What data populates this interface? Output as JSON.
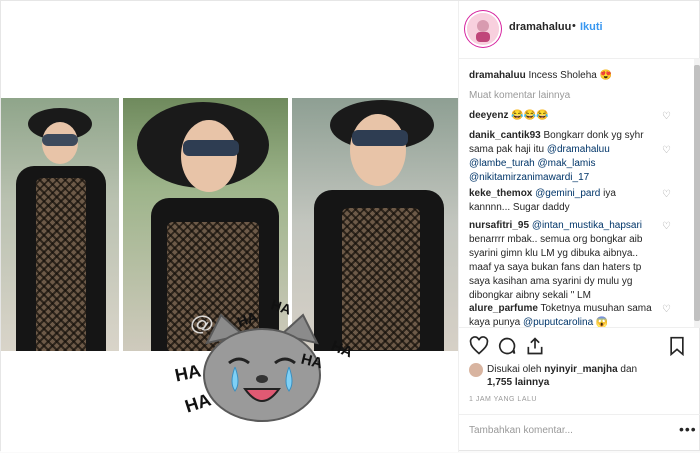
{
  "post": {
    "username": "dramahaluu",
    "separator": "•",
    "follow_label": "Ikuti",
    "watermark": "@dramahaluu",
    "haha": [
      "HA",
      "HA",
      "HA",
      "HA",
      "HA",
      "HA"
    ],
    "more_comments_label": "Muat komentar lainnya",
    "caption": {
      "user": "dramahaluu",
      "text": "Incess Sholeha 😍"
    },
    "comments": [
      {
        "user": "deeyenz",
        "text": "😂😂😂"
      },
      {
        "user": "danik_cantik93",
        "text": "Bongkarr donk yg syhr sama pak haji itu",
        "mentions": [
          "@dramahaluu",
          "@lambe_turah",
          "@mak_lamis",
          "@nikitamirzanimawardi_17"
        ]
      },
      {
        "user": "keke_themox",
        "mention": "@gemini_pard",
        "text": "iya kannnn... Sugar daddy"
      },
      {
        "user": "nursafitri_95",
        "mention": "@intan_mustika_hapsari",
        "text": "benarrrr mbak.. semua org bongkar aib syarini gimn klu LM yg dibuka aibnya.. maaf ya saya bukan fans dan haters tp saya kasihan ama syarini dy mulu yg dibongkar aibny sekali \" LM"
      },
      {
        "user": "alure_parfume",
        "text": "Toketnya musuhan sama kaya punya",
        "mention": "@puputcarolina",
        "emoji": "😱"
      }
    ],
    "likes": {
      "prefix": "Disukai oleh",
      "user": "nyinyir_manjha",
      "joiner": "dan",
      "count": "1,755",
      "suffix": "lainnya"
    },
    "time": "1 JAM YANG LALU",
    "add_comment_placeholder": "Tambahkan komentar...",
    "options_label": "•••"
  },
  "colors": {
    "link": "#3897f0",
    "mention": "#003569",
    "text": "#262626",
    "muted": "#999999"
  }
}
